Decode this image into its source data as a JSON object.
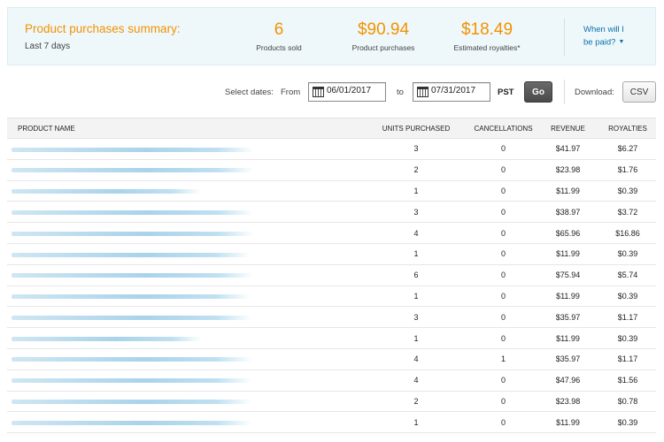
{
  "summary": {
    "title": "Product purchases summary:",
    "subtitle": "Last 7 days",
    "stats": [
      {
        "value": "6",
        "label": "Products sold"
      },
      {
        "value": "$90.94",
        "label": "Product purchases"
      },
      {
        "value": "$18.49",
        "label": "Estimated royalties*"
      }
    ],
    "paid_link_line1": "When will I",
    "paid_link_line2": "be paid?"
  },
  "filters": {
    "select_label": "Select dates:",
    "from_label": "From",
    "from_value": "06/01/2017",
    "to_label": "to",
    "to_value": "07/31/2017",
    "timezone": "PST",
    "go_label": "Go",
    "download_label": "Download:",
    "csv_label": "CSV"
  },
  "table": {
    "headers": {
      "name": "PRODUCT NAME",
      "units": "UNITS PURCHASED",
      "cancellations": "CANCELLATIONS",
      "revenue": "REVENUE",
      "royalties": "ROYALTIES"
    },
    "rows": [
      {
        "units": "3",
        "cancellations": "0",
        "revenue": "$41.97",
        "royalties": "$6.27"
      },
      {
        "units": "2",
        "cancellations": "0",
        "revenue": "$23.98",
        "royalties": "$1.76"
      },
      {
        "units": "1",
        "cancellations": "0",
        "revenue": "$11.99",
        "royalties": "$0.39"
      },
      {
        "units": "3",
        "cancellations": "0",
        "revenue": "$38.97",
        "royalties": "$3.72"
      },
      {
        "units": "4",
        "cancellations": "0",
        "revenue": "$65.96",
        "royalties": "$16.86"
      },
      {
        "units": "1",
        "cancellations": "0",
        "revenue": "$11.99",
        "royalties": "$0.39"
      },
      {
        "units": "6",
        "cancellations": "0",
        "revenue": "$75.94",
        "royalties": "$5.74"
      },
      {
        "units": "1",
        "cancellations": "0",
        "revenue": "$11.99",
        "royalties": "$0.39"
      },
      {
        "units": "3",
        "cancellations": "0",
        "revenue": "$35.97",
        "royalties": "$1.17"
      },
      {
        "units": "1",
        "cancellations": "0",
        "revenue": "$11.99",
        "royalties": "$0.39"
      },
      {
        "units": "4",
        "cancellations": "1",
        "revenue": "$35.97",
        "royalties": "$1.17"
      },
      {
        "units": "4",
        "cancellations": "0",
        "revenue": "$47.96",
        "royalties": "$1.56"
      },
      {
        "units": "2",
        "cancellations": "0",
        "revenue": "$23.98",
        "royalties": "$0.78"
      },
      {
        "units": "1",
        "cancellations": "0",
        "revenue": "$11.99",
        "royalties": "$0.39"
      }
    ]
  }
}
